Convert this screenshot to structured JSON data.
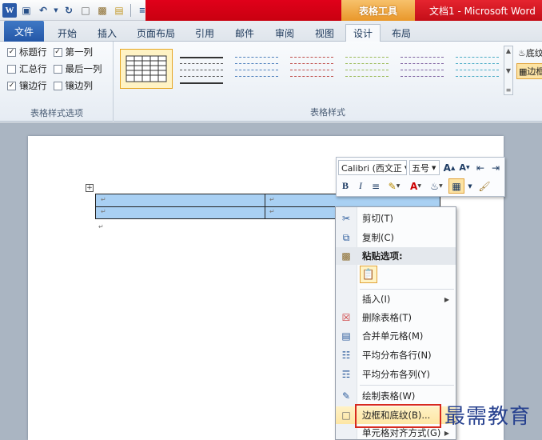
{
  "titlebar": {
    "quick_access_icons": [
      "word-icon",
      "save-icon",
      "undo-icon",
      "redo-icon",
      "new-doc-icon",
      "paste-icon",
      "folder-icon",
      "customize-icon"
    ],
    "context_tool_label": "表格工具",
    "window_title": "文档1 - Microsoft Word",
    "accent_color": "#d9131f"
  },
  "tabs": [
    {
      "label": "文件"
    },
    {
      "label": "开始"
    },
    {
      "label": "插入"
    },
    {
      "label": "页面布局"
    },
    {
      "label": "引用"
    },
    {
      "label": "邮件"
    },
    {
      "label": "审阅"
    },
    {
      "label": "视图"
    },
    {
      "label": "设计"
    },
    {
      "label": "布局"
    }
  ],
  "active_tab": "设计",
  "style_options": {
    "items": [
      {
        "label": "标题行",
        "checked": true
      },
      {
        "label": "第一列",
        "checked": true
      },
      {
        "label": "汇总行",
        "checked": false
      },
      {
        "label": "最后一列",
        "checked": false
      },
      {
        "label": "镶边行",
        "checked": true
      },
      {
        "label": "镶边列",
        "checked": false
      }
    ],
    "group_label": "表格样式选项"
  },
  "table_styles": {
    "group_label": "表格样式",
    "shading_label": "底纹",
    "border_label": "边框"
  },
  "mini_toolbar": {
    "font": "Calibri (西文正",
    "size": "五号",
    "buttons": [
      "grow-font",
      "shrink-font",
      "decrease-indent",
      "increase-indent",
      "bold",
      "italic",
      "center",
      "highlight",
      "font-color",
      "shading",
      "borders",
      "format-painter"
    ]
  },
  "context_menu": {
    "items": [
      {
        "label": "剪切(T)",
        "icon": "scissors-icon"
      },
      {
        "label": "复制(C)",
        "icon": "copy-icon"
      },
      {
        "label": "粘贴选项:",
        "icon": "paste-icon"
      },
      {
        "label": "插入(I)",
        "icon": "",
        "submenu": true
      },
      {
        "label": "删除表格(T)",
        "icon": "delete-table-icon"
      },
      {
        "label": "合并单元格(M)",
        "icon": "merge-cells-icon"
      },
      {
        "label": "平均分布各行(N)",
        "icon": "distribute-rows-icon"
      },
      {
        "label": "平均分布各列(Y)",
        "icon": "distribute-columns-icon"
      },
      {
        "label": "绘制表格(W)",
        "icon": "draw-table-icon"
      },
      {
        "label": "边框和底纹(B)...",
        "icon": "borders-shading-icon"
      },
      {
        "label": "单元格对齐方式(G)",
        "icon": "",
        "submenu": true
      }
    ]
  },
  "watermark": "最需教育"
}
